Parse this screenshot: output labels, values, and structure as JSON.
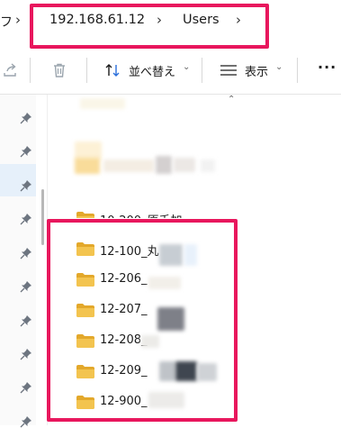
{
  "address": {
    "prev_fragment": "フ",
    "crumbs": [
      "192.168.61.12",
      "Users"
    ],
    "chevron": "›"
  },
  "toolbar": {
    "share_icon": "share-icon",
    "delete_icon": "trash-icon",
    "sort_label": "並べ替え",
    "view_label": "表示",
    "more_label": "···",
    "dropdown_chevron": "⌄"
  },
  "list": {
    "scroll_up": "⌃",
    "folders": [
      {
        "name": "10-200_原千加"
      },
      {
        "name": "12-100_丸"
      },
      {
        "name": "12-206_"
      },
      {
        "name": "12-207_"
      },
      {
        "name": "12-208_"
      },
      {
        "name": "12-209_"
      },
      {
        "name": "12-900_"
      }
    ]
  },
  "colors": {
    "highlight": "#e8175d",
    "folder": "#f3c44f",
    "folder_dark": "#e3a82b",
    "nav_selected": "#e6f0fa"
  }
}
